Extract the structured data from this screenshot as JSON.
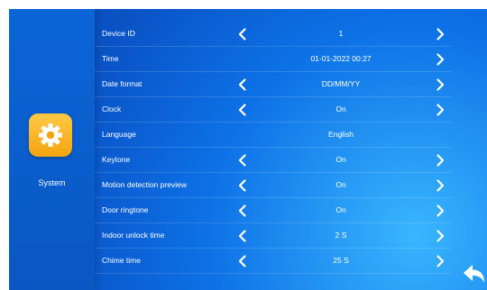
{
  "sidebar": {
    "icon": "gear-icon",
    "label": "System",
    "icon_color": "#f5a40f"
  },
  "colors": {
    "background": "#0d71e6",
    "text": "#ffffff"
  },
  "settings": [
    {
      "label": "Device ID",
      "value": "1",
      "left_arrow": true,
      "right_arrow": true
    },
    {
      "label": "Time",
      "value": "01-01-2022 00:27",
      "left_arrow": false,
      "right_arrow": true
    },
    {
      "label": "Date format",
      "value": "DD/MM/YY",
      "left_arrow": true,
      "right_arrow": true
    },
    {
      "label": "Clock",
      "value": "On",
      "left_arrow": true,
      "right_arrow": true
    },
    {
      "label": "Language",
      "value": "English",
      "left_arrow": false,
      "right_arrow": false
    },
    {
      "label": "Keytone",
      "value": "On",
      "left_arrow": true,
      "right_arrow": true
    },
    {
      "label": "Motion detection preview",
      "value": "On",
      "left_arrow": true,
      "right_arrow": true
    },
    {
      "label": "Door ringtone",
      "value": "On",
      "left_arrow": true,
      "right_arrow": true
    },
    {
      "label": "Indoor unlock time",
      "value": "2 S",
      "left_arrow": true,
      "right_arrow": true
    },
    {
      "label": "Chime time",
      "value": "25 S",
      "left_arrow": true,
      "right_arrow": true
    }
  ],
  "back_button": {
    "icon": "back-arrow-icon"
  }
}
